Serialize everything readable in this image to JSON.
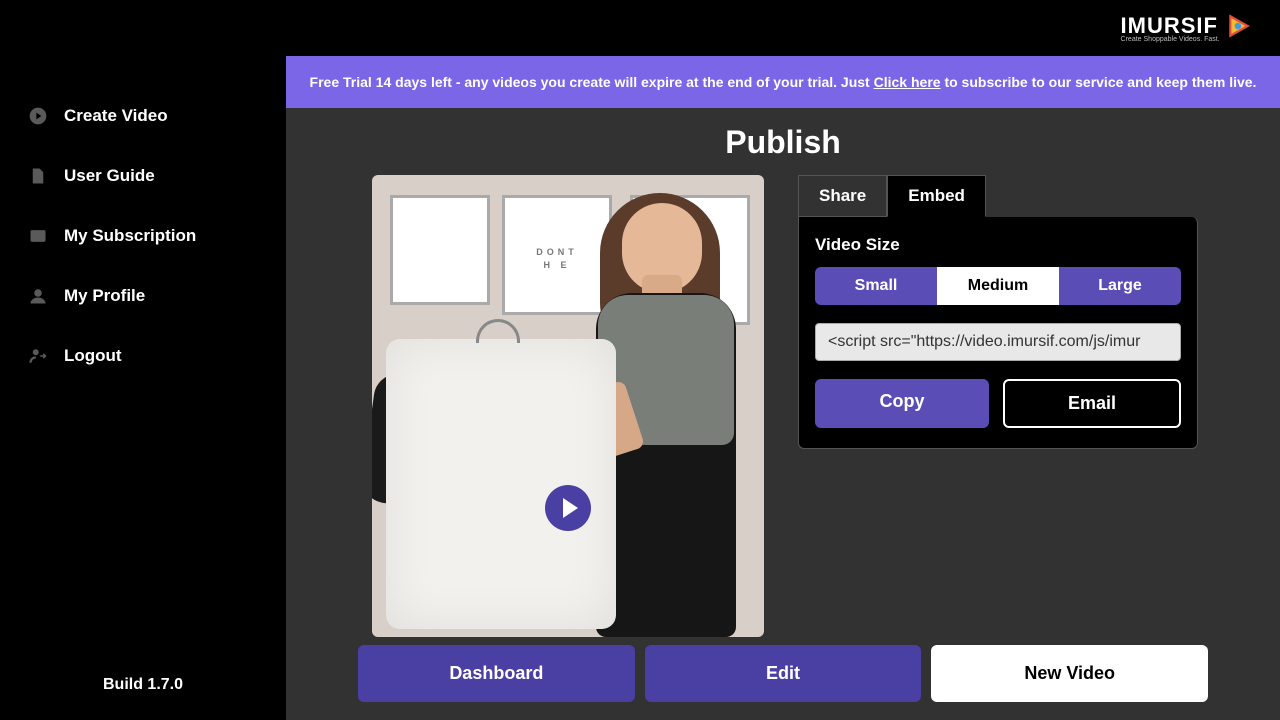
{
  "brand": {
    "name": "IMURSIF",
    "tagline": "Create Shoppable Videos. Fast."
  },
  "sidebar": {
    "items": [
      {
        "label": "Create Video"
      },
      {
        "label": "User Guide"
      },
      {
        "label": "My Subscription"
      },
      {
        "label": "My Profile"
      },
      {
        "label": "Logout"
      }
    ],
    "build": "Build 1.7.0"
  },
  "banner": {
    "prefix": "Free Trial 14 days left - any videos you create will expire at the end of your trial. Just ",
    "link": "Click here",
    "suffix": " to subscribe to our service and keep them live."
  },
  "page": {
    "title": "Publish"
  },
  "video_poster": {
    "line1": "DONT",
    "line2": "H   E"
  },
  "tabs": [
    {
      "label": "Share"
    },
    {
      "label": "Embed"
    }
  ],
  "embed_panel": {
    "size_label": "Video Size",
    "sizes": [
      {
        "label": "Small"
      },
      {
        "label": "Medium"
      },
      {
        "label": "Large"
      }
    ],
    "code": "<script src=\"https://video.imursif.com/js/imur",
    "copy": "Copy",
    "email": "Email"
  },
  "bottom": {
    "dashboard": "Dashboard",
    "edit": "Edit",
    "new_video": "New Video"
  }
}
